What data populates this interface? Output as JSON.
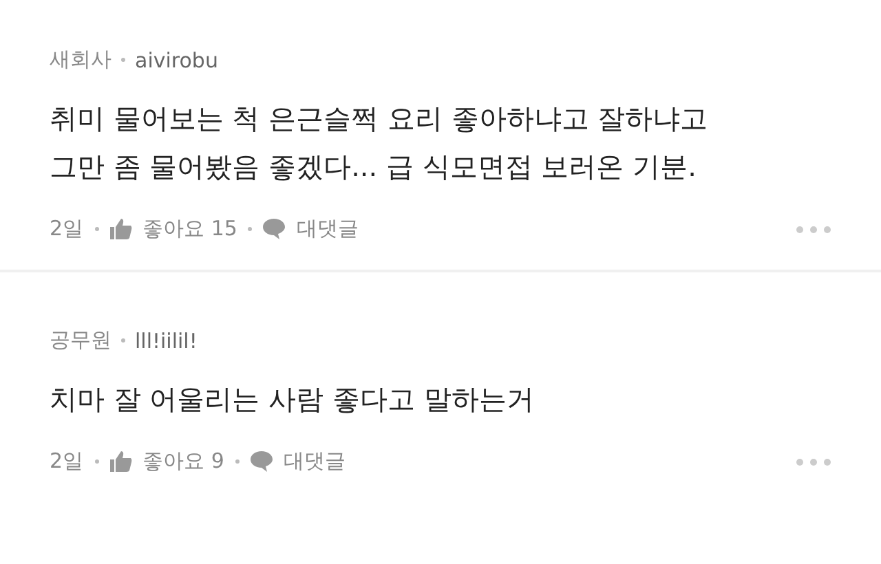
{
  "comments": [
    {
      "company": "새회사",
      "author": "aivirobu",
      "text": "취미 물어보는 척 은근슬쩍 요리 좋아하냐고 잘하냐고 그만 좀 물어봤음 좋겠다... 급 식모면접 보러온 기분.",
      "age": "2일",
      "likes": "좋아요 15",
      "reply": "대댓글"
    },
    {
      "company": "공무원",
      "author": "lll!iilil!",
      "text": "치마 잘 어울리는 사람 좋다고 말하는거",
      "age": "2일",
      "likes": "좋아요 9",
      "reply": "대댓글"
    }
  ]
}
